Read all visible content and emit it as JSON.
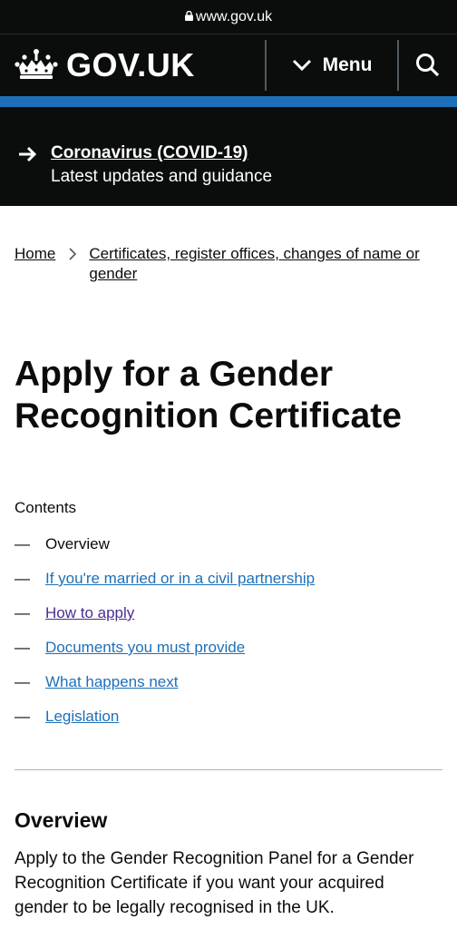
{
  "browser": {
    "url": "www.gov.uk"
  },
  "header": {
    "logo_text": "GOV.UK",
    "menu_label": "Menu"
  },
  "banner": {
    "link": "Coronavirus (COVID-19)",
    "subtitle": "Latest updates and guidance"
  },
  "breadcrumb": {
    "home": "Home",
    "section": "Certificates, register offices, changes of name or gender"
  },
  "page": {
    "title": "Apply for a Gender Recognition Certificate"
  },
  "contents": {
    "title": "Contents",
    "items": [
      {
        "label": "Overview"
      },
      {
        "label": "If you're married or in a civil partnership"
      },
      {
        "label": "How to apply"
      },
      {
        "label": "Documents you must provide"
      },
      {
        "label": "What happens next"
      },
      {
        "label": "Legislation"
      }
    ]
  },
  "section": {
    "heading": "Overview",
    "text": "Apply to the Gender Recognition Panel for a Gender Recognition Certificate if you want your acquired gender to be legally recognised in the UK."
  },
  "colors": {
    "black": "#0b0c0c",
    "link": "#1d70b8",
    "visited": "#4c2c92",
    "accent_bar": "#1d70b8",
    "rule": "#b1b4b6"
  },
  "icons": {
    "lock": "lock-icon",
    "crown": "crown-logo-icon",
    "menu": "chevron-down-icon",
    "search": "search-icon",
    "banner": "arrow-right-icon",
    "breadcrumb": "chevron-right-icon"
  }
}
